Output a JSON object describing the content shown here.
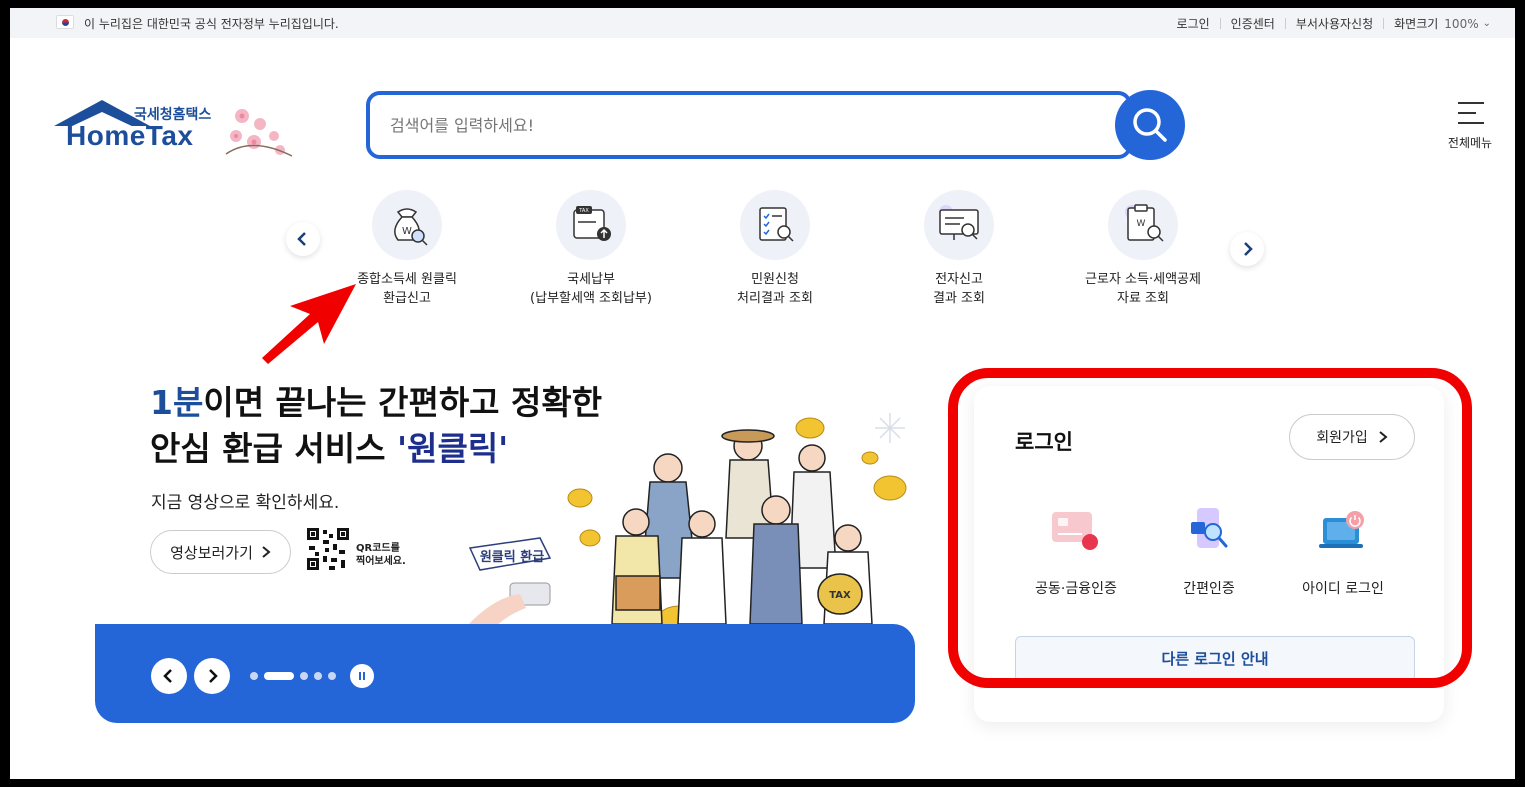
{
  "gov_bar": {
    "notice": "이 누리집은 대한민국 공식 전자정부 누리집입니다.",
    "links": [
      "로그인",
      "인증센터",
      "부서사용자신청",
      "화면크기"
    ],
    "zoom": "100%"
  },
  "logo": {
    "sub": "국세청홈택스",
    "main": "HomeTax"
  },
  "search": {
    "placeholder": "검색어를 입력하세요!"
  },
  "menu": {
    "label": "전체메뉴"
  },
  "quick_services": [
    {
      "label": "종합소득세 원클릭\n환급신고",
      "icon": "refund-money-bag-icon"
    },
    {
      "label": "국세납부\n(납부할세액 조회납부)",
      "icon": "tax-payment-card-icon"
    },
    {
      "label": "민원신청\n처리결과 조회",
      "icon": "civil-document-search-icon"
    },
    {
      "label": "전자신고\n결과 조회",
      "icon": "monitor-search-icon"
    },
    {
      "label": "근로자 소득·세액공제\n자료 조회",
      "icon": "clipboard-search-icon"
    }
  ],
  "hero": {
    "title_accent": "1분",
    "title_line1_rest": "이면 끝나는 간편하고 정확한",
    "title_line2_pre": "안심 환급 서비스 ",
    "title_line2_accent": "'원클릭'",
    "subtitle": "지금 영상으로 확인하세요.",
    "video_button": "영상보러가기",
    "qr_text": "QR코드를\n찍어보세요.",
    "badge_text": "원클릭 환급",
    "slide_count": 5,
    "active_slide": 2
  },
  "login": {
    "title": "로그인",
    "signup": "회원가입",
    "methods": [
      {
        "label": "공동·금융인증",
        "icon": "certificate-card-icon"
      },
      {
        "label": "간편인증",
        "icon": "phone-search-icon"
      },
      {
        "label": "아이디 로그인",
        "icon": "laptop-power-icon"
      }
    ],
    "other": "다른 로그인 안내"
  },
  "colors": {
    "brand": "#2466d8",
    "navy": "#1d4e9c",
    "highlight": "#f10000"
  }
}
